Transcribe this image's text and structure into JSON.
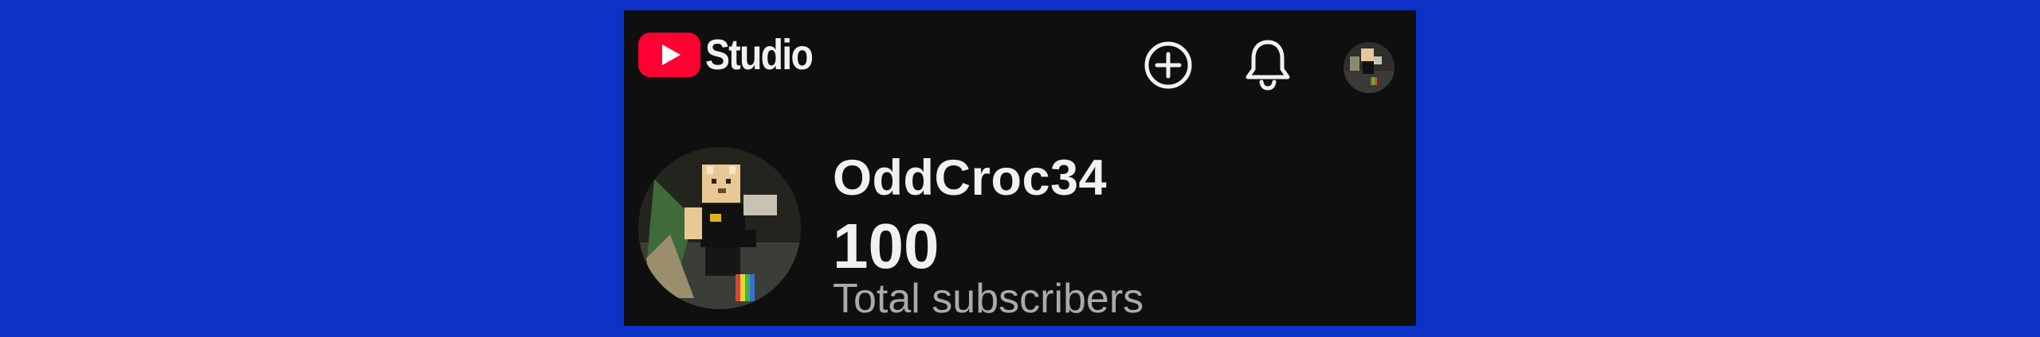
{
  "header": {
    "app_name": "Studio",
    "logo_icon": "youtube-play-icon",
    "create_icon": "plus-circle-icon",
    "notifications_icon": "bell-icon",
    "account_icon": "avatar"
  },
  "channel": {
    "name": "OddCroc34",
    "subscriber_count": "100",
    "subscriber_label": "Total subscribers"
  },
  "colors": {
    "background": "#0c32c8",
    "panel": "#0f0f0f",
    "brand_red": "#ff0033",
    "text_primary": "#f1f1f1",
    "text_secondary": "#aaaaaa"
  }
}
